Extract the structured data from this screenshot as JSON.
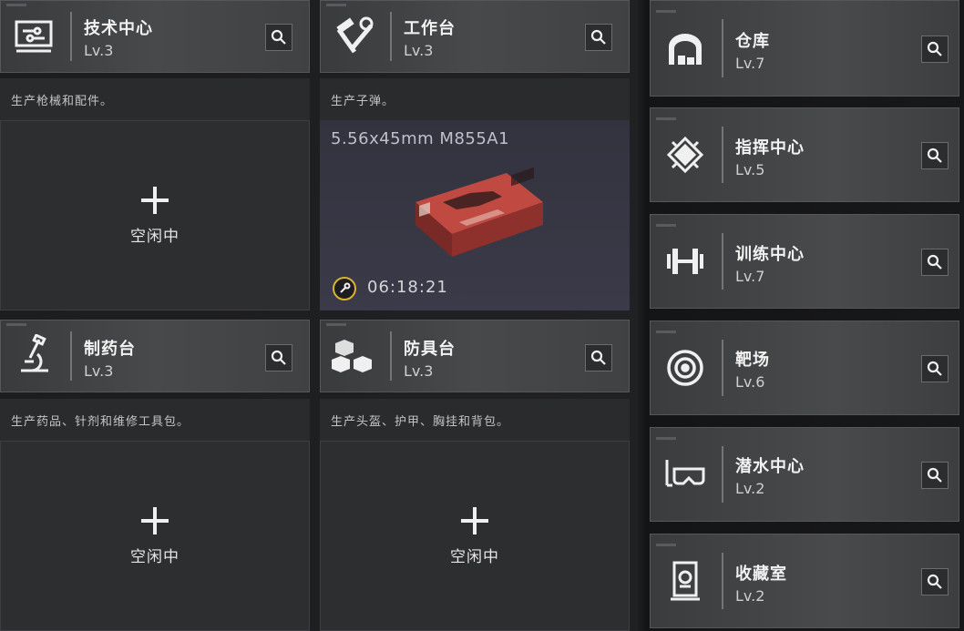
{
  "facilities": {
    "tech_center": {
      "name": "技术中心",
      "level": "Lv.3",
      "icon": "monitor-icon",
      "desc": "生产枪械和配件。",
      "slot_label": "空闲中"
    },
    "workbench": {
      "name": "工作台",
      "level": "Lv.3",
      "icon": "hammer-wrench-icon",
      "desc": "生产子弹。",
      "item": "5.56x45mm M855A1",
      "timer": "06:18:21"
    },
    "pharmacy": {
      "name": "制药台",
      "level": "Lv.3",
      "icon": "microscope-icon",
      "desc": "生产药品、针剂和维修工具包。",
      "slot_label": "空闲中"
    },
    "armor_bench": {
      "name": "防具台",
      "level": "Lv.3",
      "icon": "cubes-icon",
      "desc": "生产头盔、护甲、胸挂和背包。",
      "slot_label": "空闲中"
    }
  },
  "side_facilities": [
    {
      "name": "仓库",
      "level": "Lv.7",
      "icon": "warehouse-icon"
    },
    {
      "name": "指挥中心",
      "level": "Lv.5",
      "icon": "command-chip-icon"
    },
    {
      "name": "训练中心",
      "level": "Lv.7",
      "icon": "dumbbell-icon"
    },
    {
      "name": "靶场",
      "level": "Lv.6",
      "icon": "target-icon"
    },
    {
      "name": "潜水中心",
      "level": "Lv.2",
      "icon": "diving-mask-icon"
    },
    {
      "name": "收藏室",
      "level": "Lv.2",
      "icon": "display-case-icon"
    }
  ],
  "colors": {
    "accent_timer": "#d8b52a",
    "ammo_box": "#b8413a"
  }
}
